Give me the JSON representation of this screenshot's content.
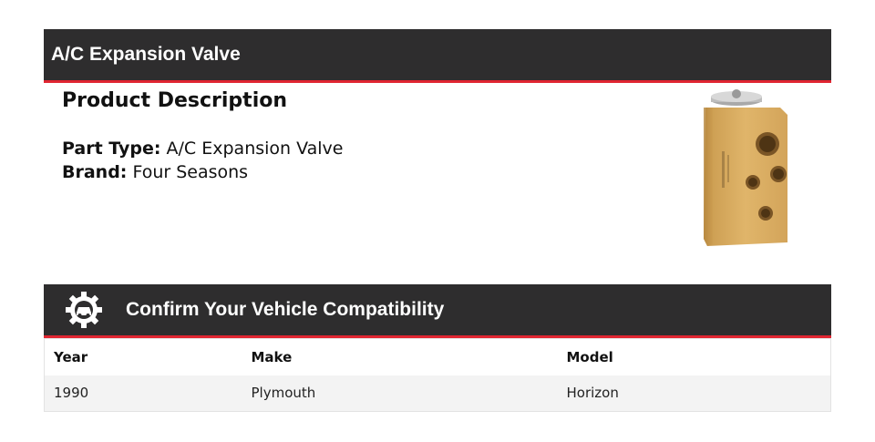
{
  "header": {
    "title": "A/C Expansion Valve"
  },
  "description": {
    "heading": "Product Description",
    "part_type_label": "Part Type:",
    "part_type_value": "A/C Expansion Valve",
    "brand_label": "Brand:",
    "brand_value": "Four Seasons"
  },
  "product_image": {
    "icon": "expansion-valve-photo"
  },
  "compatibility": {
    "title": "Confirm Your Vehicle Compatibility",
    "icon": "gear-car-icon",
    "columns": [
      "Year",
      "Make",
      "Model"
    ],
    "rows": [
      [
        "1990",
        "Plymouth",
        "Horizon"
      ]
    ]
  },
  "colors": {
    "bar_bg": "#2e2d2e",
    "accent": "#e02531",
    "row_bg": "#f3f3f3"
  }
}
